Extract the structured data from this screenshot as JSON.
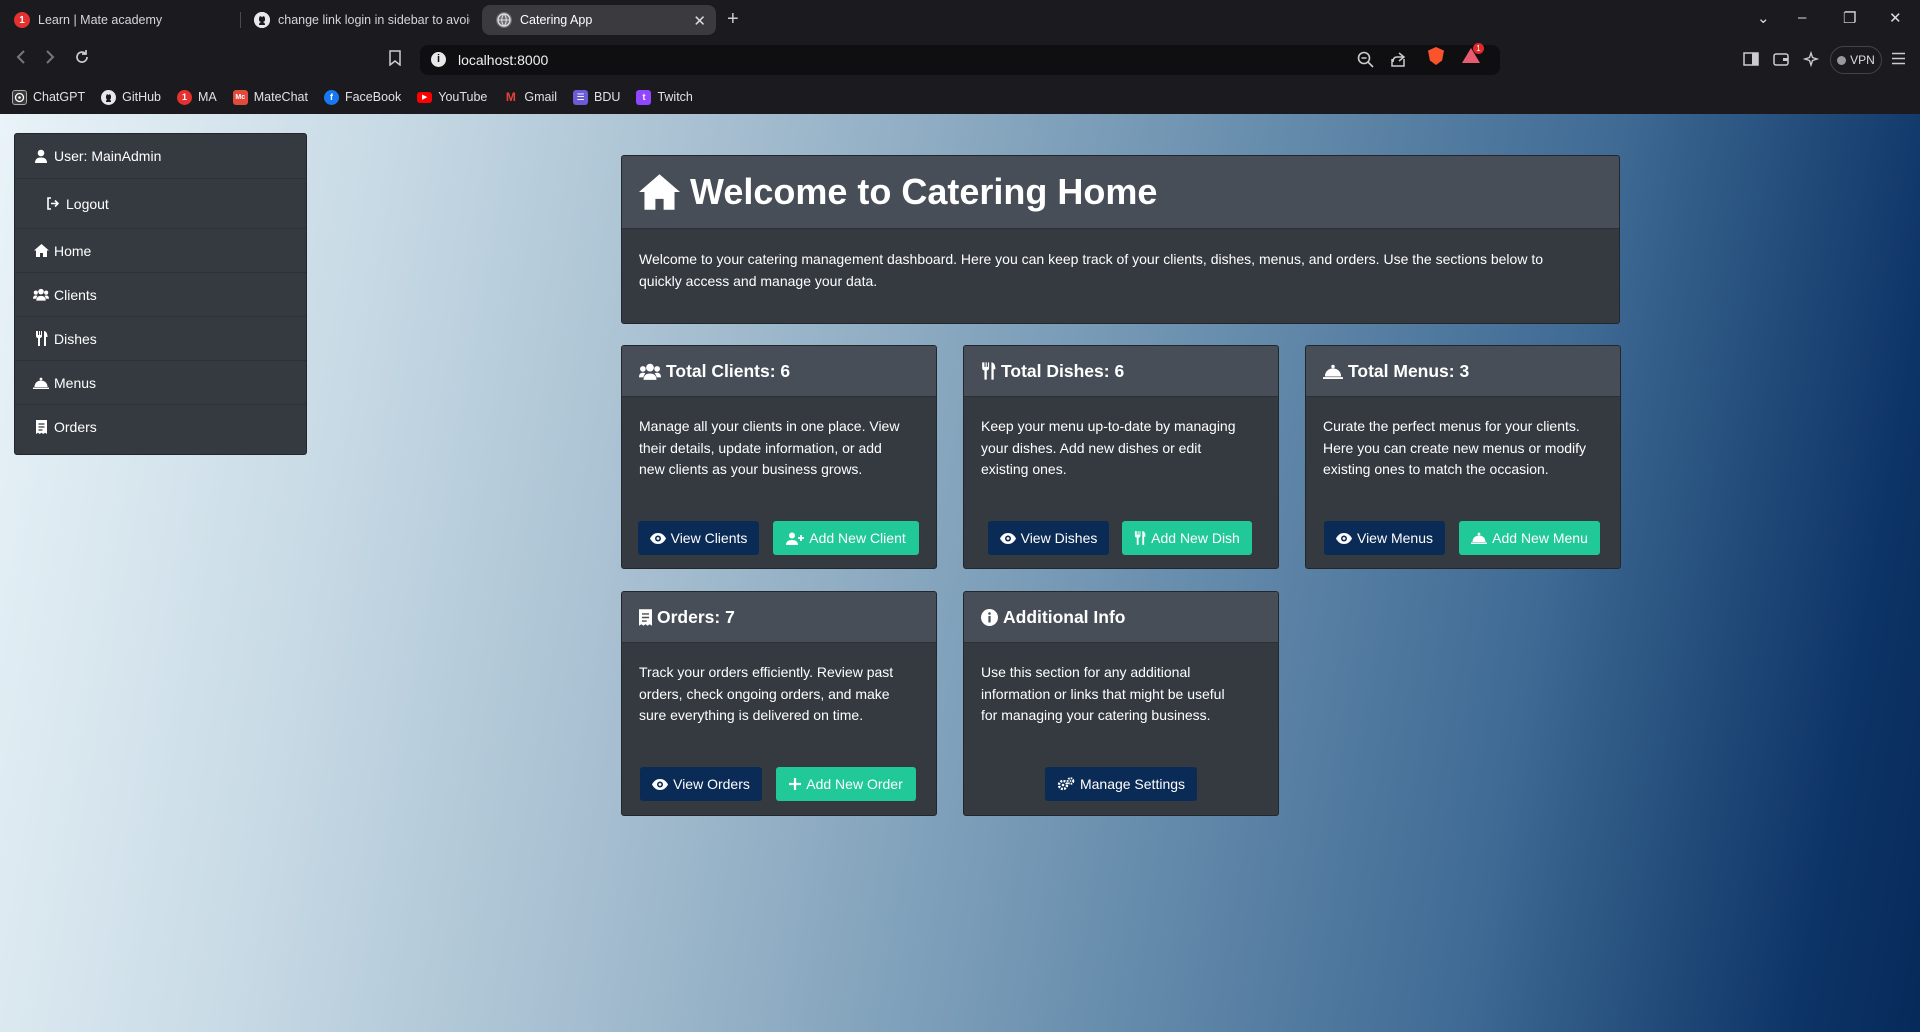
{
  "browser": {
    "tabs": [
      {
        "title": "Learn | Mate academy",
        "badge": "1"
      },
      {
        "title": "change link login in sidebar to avoid"
      },
      {
        "title": "Catering App",
        "close": "✕"
      }
    ],
    "new_tab": "+",
    "window_controls": {
      "dropdown": "⌄",
      "minimize": "–",
      "restore": "❐",
      "close": "✕"
    },
    "address": "localhost:8000",
    "vpn_label": "VPN",
    "bat_badge": "1",
    "bookmarks": [
      {
        "label": "ChatGPT",
        "icon": "chatgpt-icon",
        "color": "#3a3a3a"
      },
      {
        "label": "GitHub",
        "icon": "github-icon",
        "color": "#2b2b2b"
      },
      {
        "label": "MA",
        "icon": "mate-academy-icon",
        "color": "#e5312f",
        "badge": "1"
      },
      {
        "label": "MateChat",
        "icon": "matechat-icon",
        "color": "#e24a3b",
        "badge": "Mc"
      },
      {
        "label": "FaceBook",
        "icon": "facebook-icon",
        "color": "#1877f2",
        "badge": "f"
      },
      {
        "label": "YouTube",
        "icon": "youtube-icon",
        "color": "#ff0000",
        "badge": "▶"
      },
      {
        "label": "Gmail",
        "icon": "gmail-icon",
        "color": "#ffffff",
        "badge": "M"
      },
      {
        "label": "BDU",
        "icon": "bdu-icon",
        "color": "#6b5bd6",
        "badge": "☰"
      },
      {
        "label": "Twitch",
        "icon": "twitch-icon",
        "color": "#9146ff",
        "badge": "t"
      }
    ]
  },
  "sidebar": {
    "user": "User: MainAdmin",
    "logout": "Logout",
    "items": [
      {
        "label": "Home",
        "icon": "home-icon"
      },
      {
        "label": "Clients",
        "icon": "users-icon"
      },
      {
        "label": "Dishes",
        "icon": "utensils-icon"
      },
      {
        "label": "Menus",
        "icon": "cloche-icon"
      },
      {
        "label": "Orders",
        "icon": "receipt-icon"
      }
    ]
  },
  "welcome": {
    "title": "Welcome to Catering Home",
    "text_line1": "Welcome to your catering management dashboard. Here you can keep track of your clients, dishes, menus, and orders. Use the sections below to",
    "text_line2": "quickly access and manage your data."
  },
  "cards": {
    "clients": {
      "title": "Total Clients: 6",
      "lines": [
        "Manage all your clients in one place. View",
        "their details, update information, or add",
        "new clients as your business grows."
      ],
      "view": "View Clients",
      "add": "Add New Client"
    },
    "dishes": {
      "title": "Total Dishes: 6",
      "lines": [
        "Keep your menu up-to-date by managing",
        "your dishes. Add new dishes or edit",
        "existing ones."
      ],
      "view": "View Dishes",
      "add": "Add New Dish"
    },
    "menus": {
      "title": "Total Menus: 3",
      "lines": [
        "Curate the perfect menus for your clients.",
        "Here you can create new menus or modify",
        "existing ones to match the occasion."
      ],
      "view": "View Menus",
      "add": "Add New Menu"
    },
    "orders": {
      "title": "Orders: 7",
      "lines": [
        "Track your orders efficiently. Review past",
        "orders, check ongoing orders, and make",
        "sure everything is delivered on time."
      ],
      "view": "View Orders",
      "add": "Add New Order"
    },
    "info": {
      "title": "Additional Info",
      "lines": [
        "Use this section for any additional",
        "information or links that might be useful",
        "for managing your catering business."
      ],
      "action": "Manage Settings"
    }
  },
  "colors": {
    "card_bg": "#343a40",
    "card_header": "#474e57",
    "btn_dark": "#0b2b57",
    "btn_green": "#20c997"
  }
}
